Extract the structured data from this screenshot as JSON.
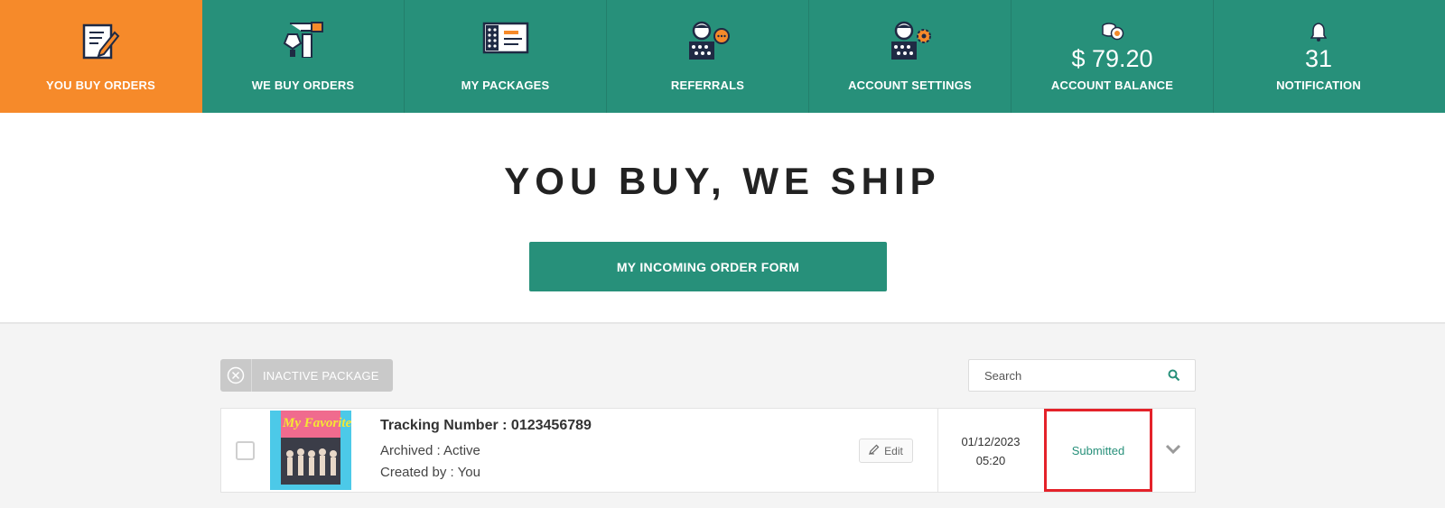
{
  "nav": {
    "items": [
      {
        "label": "YOU BUY ORDERS",
        "icon": "edit-document-icon",
        "active": true
      },
      {
        "label": "WE BUY ORDERS",
        "icon": "hand-shopping-icon"
      },
      {
        "label": "MY PACKAGES",
        "icon": "package-icon"
      },
      {
        "label": "REFERRALS",
        "icon": "referral-person-icon"
      },
      {
        "label": "ACCOUNT SETTINGS",
        "icon": "person-gear-icon"
      },
      {
        "label": "ACCOUNT BALANCE",
        "value": "$ 79.20",
        "icon": "coins-icon"
      },
      {
        "label": "NOTIFICATION",
        "value": "31",
        "icon": "bell-icon"
      }
    ]
  },
  "hero": {
    "title": "YOU BUY, WE SHIP",
    "button_label": "MY INCOMING ORDER FORM"
  },
  "toolbar": {
    "inactive_label": "INACTIVE PACKAGE",
    "search_placeholder": "Search"
  },
  "order": {
    "tracking": "Tracking Number : 0123456789",
    "archived": "Archived : Active",
    "created_by": "Created by : You",
    "edit_label": "Edit",
    "date": "01/12/2023",
    "time": "05:20",
    "status": "Submitted",
    "thumbnail_text": "My Favorite"
  },
  "colors": {
    "primary": "#27907a",
    "active": "#f68a2a",
    "highlight": "#e4222a"
  }
}
